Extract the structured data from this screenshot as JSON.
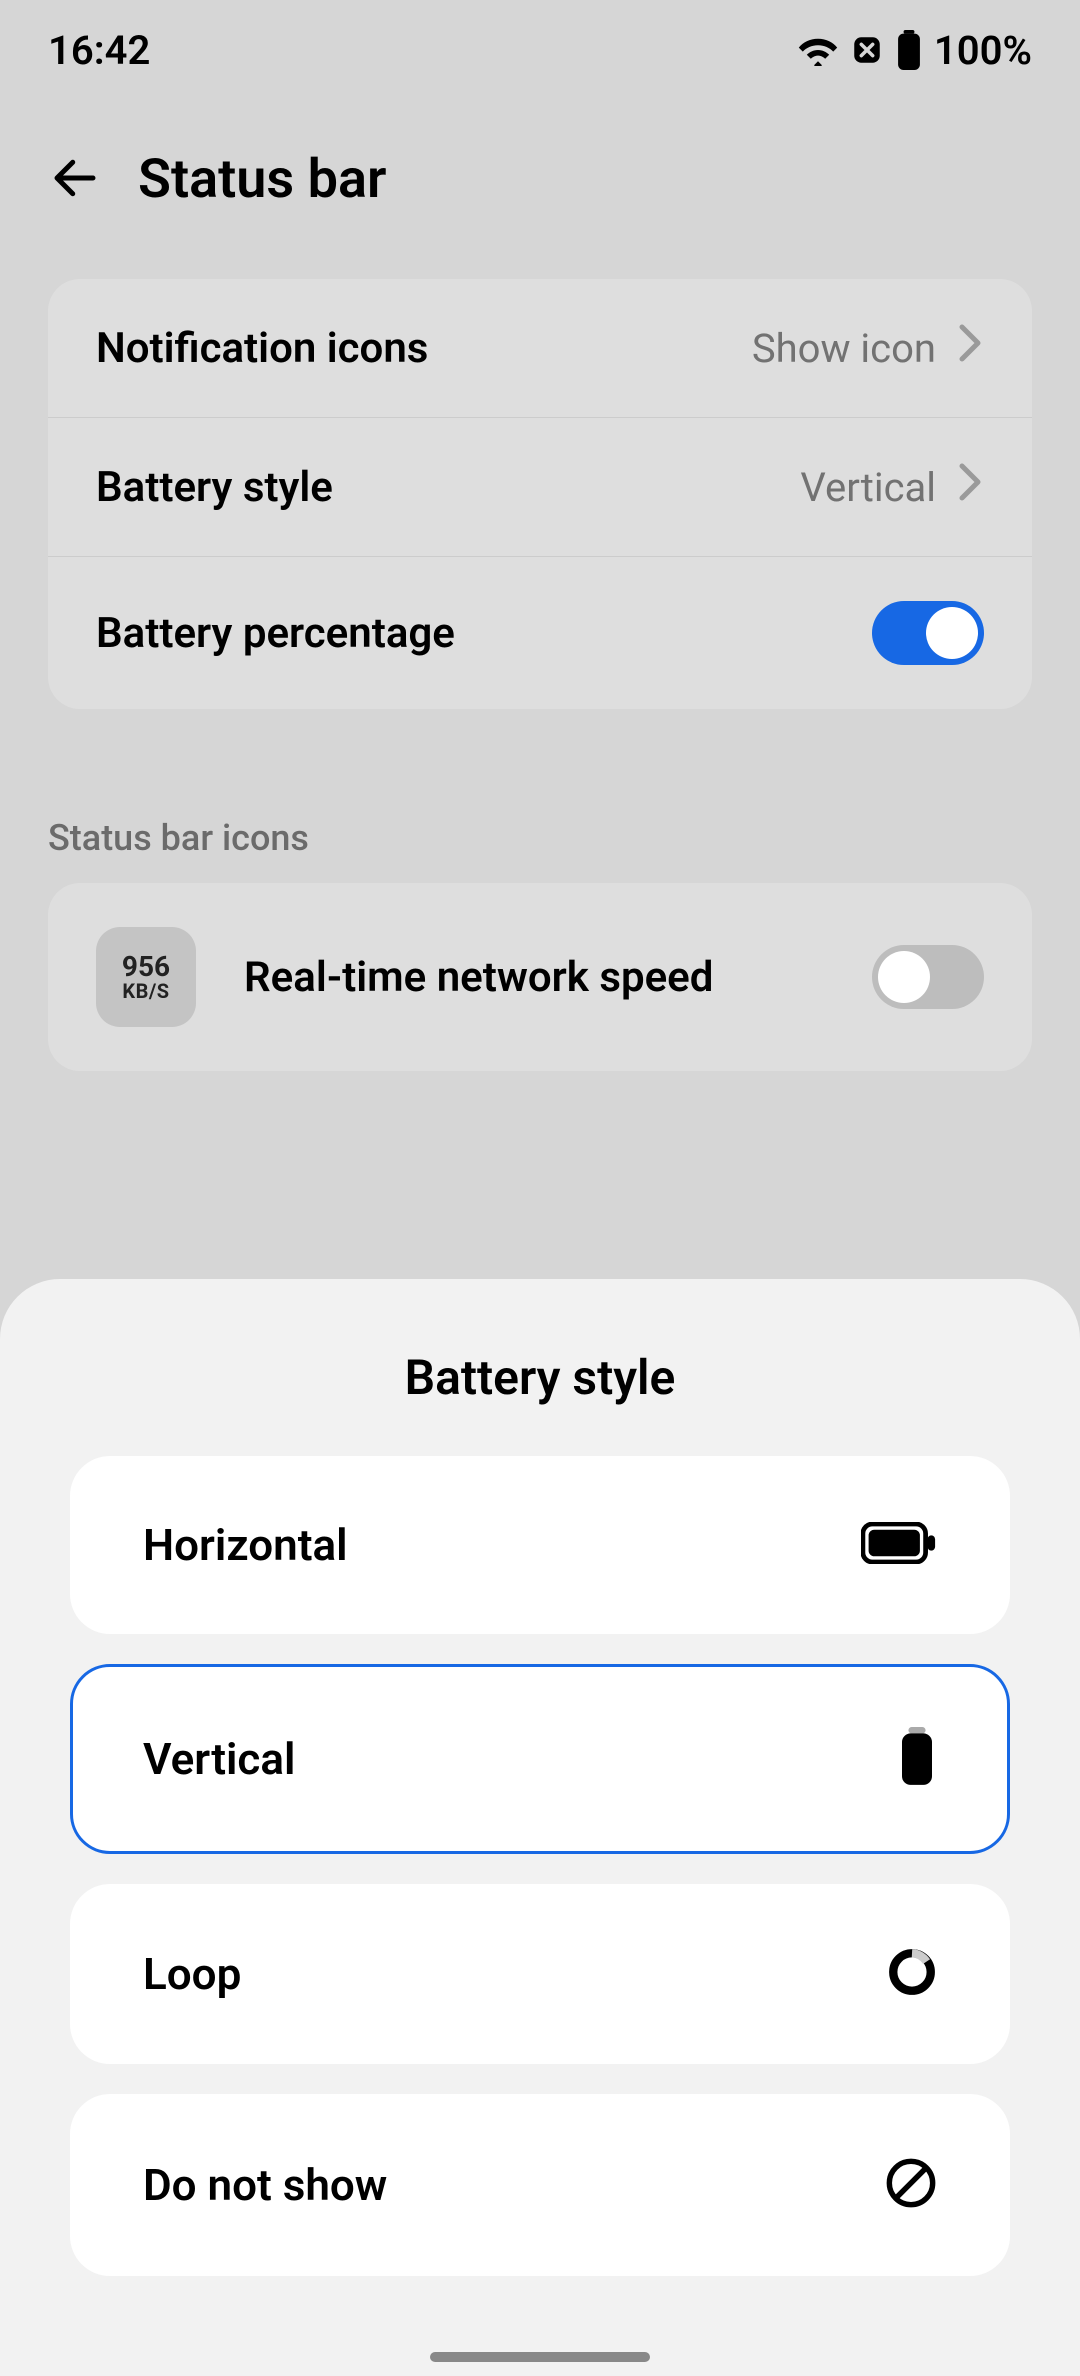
{
  "statusbar": {
    "time": "16:42",
    "battery_pct": "100%"
  },
  "page": {
    "title": "Status bar"
  },
  "settings": {
    "notification_icons": {
      "label": "Notification icons",
      "value": "Show icon"
    },
    "battery_style": {
      "label": "Battery style",
      "value": "Vertical"
    },
    "battery_percentage": {
      "label": "Battery percentage",
      "on": true
    }
  },
  "section": {
    "status_bar_icons_header": "Status bar icons",
    "network_speed": {
      "label": "Real-time network speed",
      "icon_top": "956",
      "icon_bottom": "KB/S",
      "on": false
    }
  },
  "sheet": {
    "title": "Battery style",
    "options": {
      "horizontal": "Horizontal",
      "vertical": "Vertical",
      "loop": "Loop",
      "none": "Do not show"
    },
    "selected": "vertical"
  }
}
